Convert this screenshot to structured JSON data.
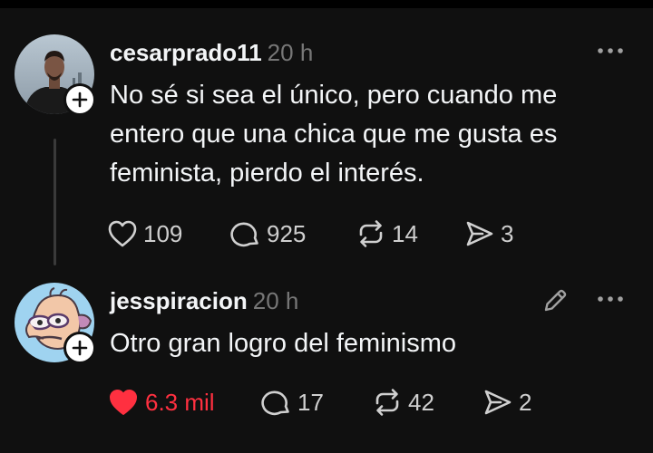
{
  "colors": {
    "background": "#101010",
    "text": "#f3f5f7",
    "muted": "#777777",
    "like_active": "#ff3040"
  },
  "posts": [
    {
      "username": "cesarprado11",
      "time": "20 h",
      "text": "No sé si sea el único, pero cuando me entero que una chica que me gusta es feminista, pierdo el interés.",
      "likes": "109",
      "comments": "925",
      "reposts": "14",
      "shares": "3",
      "liked": false
    },
    {
      "username": "jesspiracion",
      "time": "20 h",
      "text": "Otro gran logro del feminismo",
      "likes": "6.3 mil",
      "comments": "17",
      "reposts": "42",
      "shares": "2",
      "liked": true
    }
  ],
  "icons": {
    "follow": "plus-icon",
    "more": "more-dots-icon",
    "edit": "pencil-icon",
    "like": "heart-icon",
    "comment": "comment-bubble-icon",
    "repost": "repost-arrows-icon",
    "share": "send-icon"
  }
}
